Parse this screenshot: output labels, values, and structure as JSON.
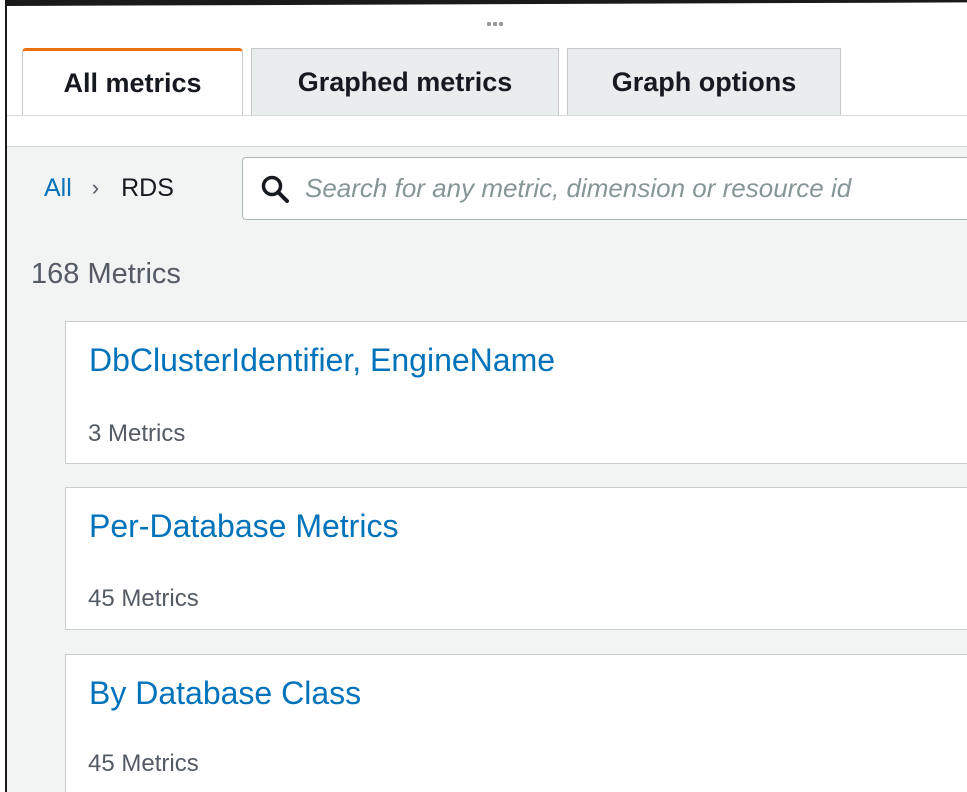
{
  "tabs": [
    {
      "label": "All metrics",
      "active": true
    },
    {
      "label": "Graphed metrics",
      "active": false
    },
    {
      "label": "Graph options",
      "active": false
    }
  ],
  "breadcrumb": {
    "root": "All",
    "separator": "›",
    "current": "RDS"
  },
  "search": {
    "placeholder": "Search for any metric, dimension or resource id",
    "value": ""
  },
  "metrics_count": "168 Metrics",
  "groups": [
    {
      "title": "DbClusterIdentifier, EngineName",
      "count": "3 Metrics"
    },
    {
      "title": "Per-Database Metrics",
      "count": "45 Metrics"
    },
    {
      "title": "By Database Class",
      "count": "45 Metrics"
    }
  ],
  "colors": {
    "accent_tab": "#ec7211",
    "link": "#0073bb",
    "background": "#f2f3f3"
  }
}
